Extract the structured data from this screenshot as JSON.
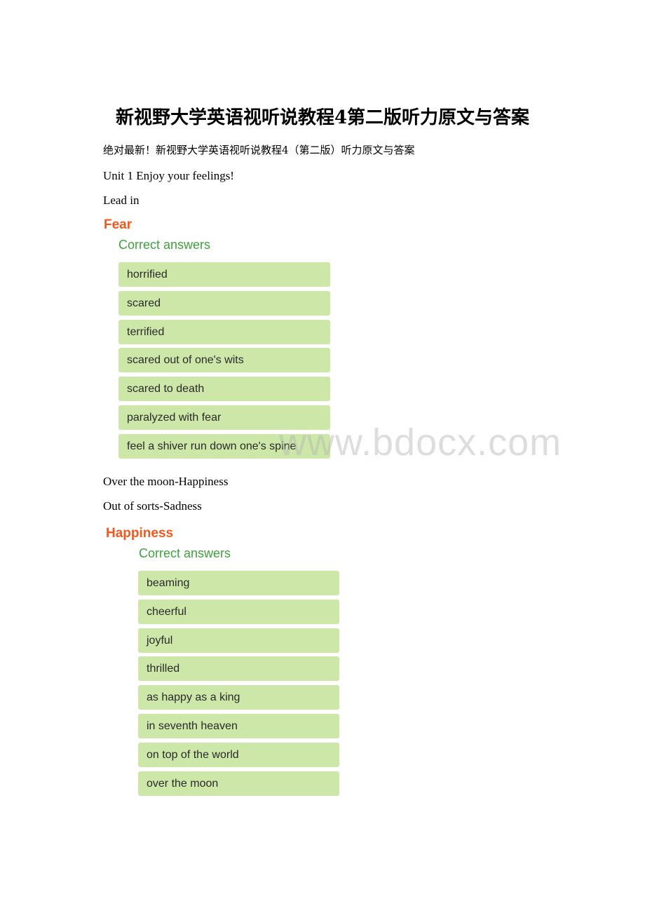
{
  "document": {
    "title": "新视野大学英语视听说教程4第二版听力原文与答案",
    "intro": "绝对最新！新视野大学英语视听说教程4（第二版）听力原文与答案",
    "unit_heading": "Unit 1 Enjoy your feelings!",
    "section_heading": "Lead in",
    "note_happiness": "Over the moon-Happiness",
    "note_sadness": "Out of sorts-Sadness"
  },
  "fear_panel": {
    "category": "Fear",
    "label": "Correct answers",
    "answers": [
      "horrified",
      "scared",
      "terrified",
      "scared out of one's wits",
      "scared to death",
      "paralyzed with fear",
      "feel a shiver run down one's spine"
    ]
  },
  "happiness_panel": {
    "category": "Happiness",
    "label": "Correct answers",
    "answers": [
      "beaming",
      "cheerful",
      "joyful",
      "thrilled",
      "as happy as a king",
      "in seventh heaven",
      "on top of the world",
      "over the moon"
    ]
  },
  "watermark": "www.bdocx.com",
  "colors": {
    "category_title": "#f4581e",
    "correct_label": "#3ea33a",
    "answer_bg": "#cde7a8"
  }
}
